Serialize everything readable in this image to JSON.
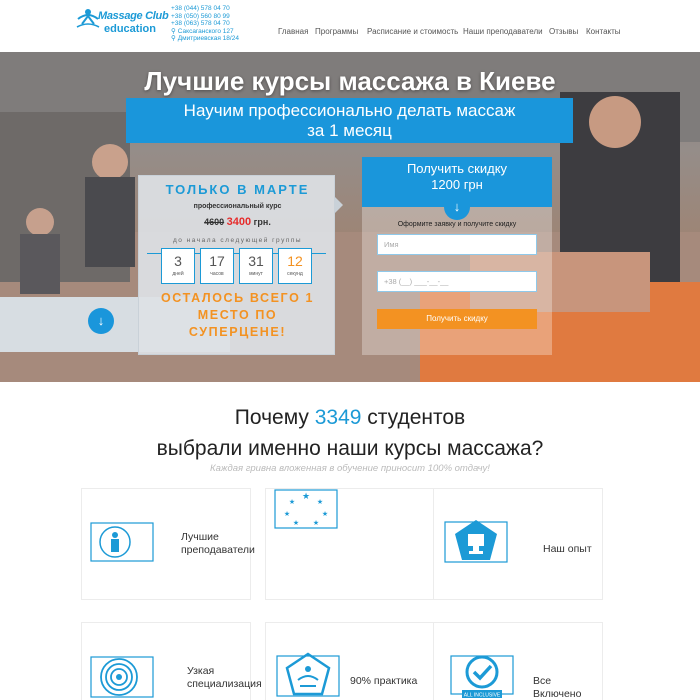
{
  "header": {
    "logo_line1": "Massage Club",
    "logo_line2": "education",
    "phones": [
      "+38 (044) 578 04 70",
      "+38 (050) 560 80 99",
      "+38 (063) 578 04 70"
    ],
    "addresses": [
      "Саксаганского 127",
      "Дмитриевская 18/24"
    ],
    "nav": [
      "Главная",
      "Программы",
      "Расписание и стоимость",
      "Наши преподаватели",
      "Отзывы",
      "Контакты"
    ]
  },
  "hero": {
    "title": "Лучшие курсы массажа в Киеве",
    "subtitle_line1": "Научим профессионально делать массаж",
    "subtitle_line2": "за 1 месяц"
  },
  "promo": {
    "tag": "ТОЛЬКО В МАРТЕ",
    "course": "профессиональный курс",
    "old_price": "4600",
    "new_price": "3400",
    "currency": "грн.",
    "until": "до начала следующей группы",
    "countdown": [
      {
        "value": "3",
        "unit": "дней"
      },
      {
        "value": "17",
        "unit": "часов"
      },
      {
        "value": "31",
        "unit": "минут"
      },
      {
        "value": "12",
        "unit": "секунд"
      }
    ],
    "left_line1": "ОСТАЛОСЬ ВСЕГО 1",
    "left_line2": "МЕСТО ПО",
    "left_line3": "СУПЕРЦЕНЕ!"
  },
  "form": {
    "head_line1": "Получить скидку",
    "head_line2": "1200 грн",
    "note": "Оформите заявку и получите скидку",
    "name_placeholder": "Имя",
    "phone_placeholder": "+38 (__) ___-__-__",
    "submit_label": "Получить скидку"
  },
  "why": {
    "title_prefix": "Почему ",
    "students": "3349",
    "title_suffix": " студентов",
    "title_line2": "выбрали именно наши курсы массажа?",
    "subtitle": "Каждая гривна вложенная в обучение приносит 100% отдачу!",
    "cards": [
      {
        "label_line1": "Лучшие",
        "label_line2": "преподаватели",
        "icon": "teacher-icon"
      },
      {
        "label_line1": "",
        "label_line2": "",
        "icon": "stars-icon"
      },
      {
        "label_line1": "Наш опыт",
        "label_line2": "",
        "icon": "trophy-icon"
      },
      {
        "label_line1": "Узкая",
        "label_line2": "специализация",
        "icon": "target-icon"
      },
      {
        "label_line1": "90% практика",
        "label_line2": "",
        "icon": "yoga-icon"
      },
      {
        "label_line1": "Все Включено",
        "label_line2": "",
        "icon": "checkmark-icon"
      }
    ],
    "all_inclusive_badge": "ALL INCLUSIVE"
  },
  "colors": {
    "accent": "#1a96db",
    "orange": "#f39222",
    "red": "#e62b2b"
  }
}
